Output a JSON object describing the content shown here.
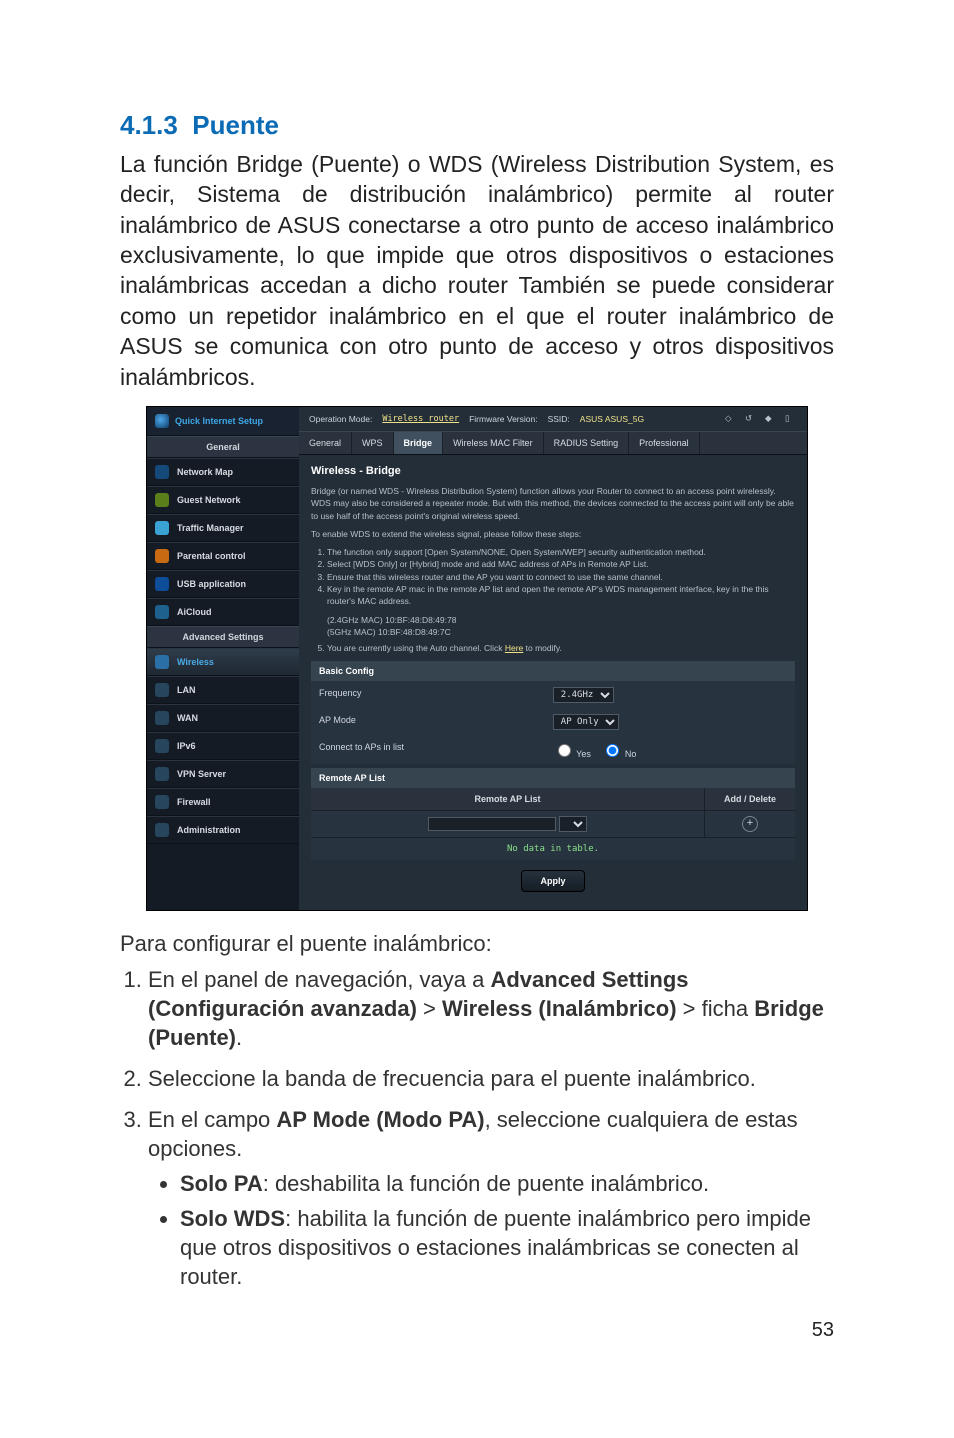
{
  "doc": {
    "section_no": "4.1.3",
    "section_title": "Puente",
    "intro": "La función Bridge (Puente) o WDS (Wireless Distribution System, es decir, Sistema de distribución inalámbrico) permite al router inalámbrico de ASUS conectarse a otro punto de acceso inalámbrico exclusivamente, lo que impide que otros dispositivos o estaciones inalámbricas accedan a dicho router También se puede considerar como un repetidor inalámbrico en el que el router inalámbrico de ASUS se comunica con otro punto de acceso y otros dispositivos inalámbricos.",
    "lead2": "Para configurar el puente inalámbrico:",
    "step1_a": "En el panel de navegación, vaya a ",
    "step1_b1": "Advanced Settings (Configuración avanzada)",
    "step1_gt1": " > ",
    "step1_b2": "Wireless (Inalámbrico)",
    "step1_gt2": " > ficha ",
    "step1_b3": "Bridge (Puente)",
    "step1_end": ".",
    "step2": "Seleccione la banda de frecuencia para el puente inalámbrico.",
    "step3_a": "En el campo ",
    "step3_b": "AP Mode (Modo PA)",
    "step3_c": ", seleccione cualquiera de estas opciones.",
    "bullet1_b": "Solo PA",
    "bullet1_t": ": deshabilita la función de puente inalámbrico.",
    "bullet2_b": "Solo WDS",
    "bullet2_t": ": habilita la función de puente inalámbrico pero impide que otros dispositivos o estaciones inalámbricas se conecten al router.",
    "page_no": "53"
  },
  "ui": {
    "qis": "Quick Internet Setup",
    "sidebar": {
      "general": "General",
      "advanced": "Advanced Settings",
      "items_general": [
        "Network Map",
        "Guest Network",
        "Traffic Manager",
        "Parental control",
        "USB application",
        "AiCloud"
      ],
      "items_advanced": [
        "Wireless",
        "LAN",
        "WAN",
        "IPv6",
        "VPN Server",
        "Firewall",
        "Administration"
      ]
    },
    "topbar": {
      "opmode_label": "Operation Mode:",
      "opmode_value": "Wireless router",
      "fw_label": "Firmware Version:",
      "ssid_label": "SSID:",
      "ssid_values": "ASUS  ASUS_5G"
    },
    "tabs": [
      "General",
      "WPS",
      "Bridge",
      "Wireless MAC Filter",
      "RADIUS Setting",
      "Professional"
    ],
    "panel": {
      "title": "Wireless - Bridge",
      "p1": "Bridge (or named WDS - Wireless Distribution System) function allows your Router to connect to an access point wirelessly. WDS may also be considered a repeater mode. But with this method, the devices connected to the access point will only be able to use half of the access point's original wireless speed.",
      "p2": "To enable WDS to extend the wireless signal, please follow these steps:",
      "li1": "The function only support [Open System/NONE, Open System/WEP] security authentication method.",
      "li2": "Select [WDS Only] or [Hybrid] mode and add MAC address of APs in Remote AP List.",
      "li3": "Ensure that this wireless router and the AP you want to connect to use the same channel.",
      "li4": "Key in the remote AP mac in the remote AP list and open the remote AP's WDS management interface, key in the this router's MAC address.",
      "mac24": "(2.4GHz MAC) 10:BF:48:D8:49:78",
      "mac5": "(5GHz MAC) 10:BF:48:D8:49:7C",
      "li5_a": "You are currently using the Auto channel. Click ",
      "li5_link": "Here",
      "li5_b": " to modify.",
      "basic_config": "Basic Config",
      "freq_label": "Frequency",
      "freq_value": "2.4GHz",
      "apmode_label": "AP Mode",
      "apmode_value": "AP Only",
      "connect_label": "Connect to APs in list",
      "yes": "Yes",
      "no": "No",
      "remote_ap_list_bar": "Remote AP List",
      "remote_head": "Remote AP List",
      "add_delete": "Add / Delete",
      "no_data": "No data in table.",
      "apply": "Apply"
    }
  }
}
